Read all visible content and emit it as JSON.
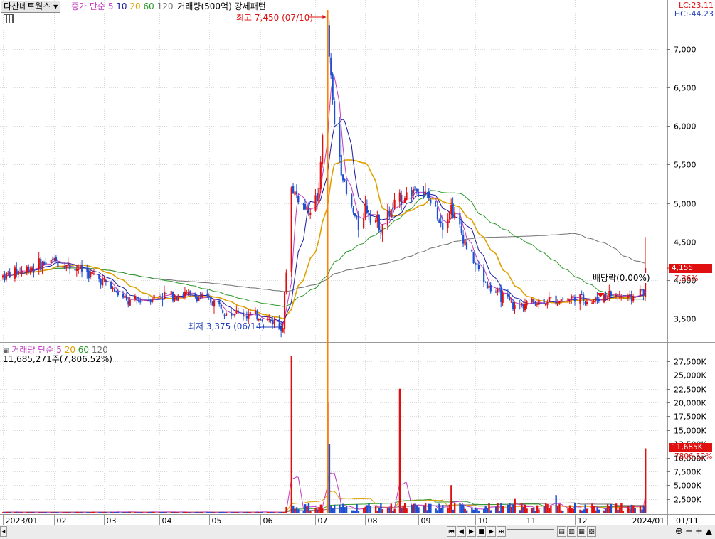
{
  "header": {
    "stock_name": "다산네트웍스",
    "ma_legend": {
      "label": "종가 단순",
      "periods": [
        "5",
        "10",
        "20",
        "60",
        "120"
      ]
    },
    "volume_label": "거래량(500억)",
    "pattern_label": "강세패턴",
    "lc": "LC:23.11",
    "hc": "HC:-44.23"
  },
  "annotations": {
    "high": "최고 7,450 (07/10)",
    "low": "최저 3,375 (06/14)",
    "dividend": "배당락(0.00%)",
    "last_price": "4,155",
    "last_change": "7.36%"
  },
  "volume_panel": {
    "legend_label": "거래량",
    "ma_legend": {
      "label": "단순",
      "periods": [
        "5",
        "20",
        "60",
        "120"
      ]
    },
    "current": "11,685,271주(7,806.52%)",
    "last_volume_tag": "11,685K",
    "last_ratio": "7806.52%"
  },
  "colors": {
    "up": "#e01010",
    "down": "#1f4fd0",
    "ma5": "#c03cc0",
    "ma10": "#1a1aa0",
    "ma20": "#e0a000",
    "ma60": "#2a9a2a",
    "ma120": "#707070",
    "marker": "#ff8000"
  },
  "chart_data": {
    "type": "candlestick",
    "price_axis": {
      "ticks": [
        3500,
        4000,
        4500,
        5000,
        5500,
        6000,
        6500,
        7000
      ],
      "tick_labels": [
        "3,500",
        "4,000",
        "4,500",
        "5,000",
        "5,500",
        "6,000",
        "6,500",
        "7,000"
      ]
    },
    "volume_axis": {
      "ticks": [
        2500,
        5000,
        7500,
        10000,
        12500,
        15000,
        17500,
        20000,
        22500,
        25000,
        27500
      ],
      "tick_labels": [
        "2,500K",
        "5,000K",
        "7,500K",
        "10,000K",
        "12,500K",
        "15,000K",
        "17,500K",
        "20,000K",
        "22,500K",
        "25,000K",
        "27,500K"
      ]
    },
    "x_labels": [
      {
        "text": "2023/01",
        "date": "2023-01-02"
      },
      {
        "text": "02",
        "date": "2023-02-01"
      },
      {
        "text": "03",
        "date": "2023-03-02"
      },
      {
        "text": "04",
        "date": "2023-04-03"
      },
      {
        "text": "05",
        "date": "2023-05-02"
      },
      {
        "text": "06",
        "date": "2023-06-01"
      },
      {
        "text": "07",
        "date": "2023-07-03"
      },
      {
        "text": "08",
        "date": "2023-08-01"
      },
      {
        "text": "09",
        "date": "2023-09-01"
      },
      {
        "text": "10",
        "date": "2023-10-04"
      },
      {
        "text": "11",
        "date": "2023-11-01"
      },
      {
        "text": "12",
        "date": "2023-12-01"
      },
      {
        "text": "2024/01",
        "date": "2024-01-02"
      },
      {
        "text": "01/11",
        "date": "2024-01-11"
      }
    ],
    "close_path": [
      [
        "2023-01-02",
        4050
      ],
      [
        "2023-01-16",
        4150
      ],
      [
        "2023-02-01",
        4250
      ],
      [
        "2023-02-15",
        4150
      ],
      [
        "2023-03-02",
        3980
      ],
      [
        "2023-03-16",
        3700
      ],
      [
        "2023-04-03",
        3800
      ],
      [
        "2023-04-17",
        3820
      ],
      [
        "2023-05-02",
        3740
      ],
      [
        "2023-05-16",
        3580
      ],
      [
        "2023-06-01",
        3520
      ],
      [
        "2023-06-14",
        3420
      ],
      [
        "2023-06-19",
        5200
      ],
      [
        "2023-06-28",
        4900
      ],
      [
        "2023-07-05",
        5100
      ],
      [
        "2023-07-10",
        7200
      ],
      [
        "2023-07-14",
        6000
      ],
      [
        "2023-07-21",
        5100
      ],
      [
        "2023-07-28",
        4700
      ],
      [
        "2023-08-01",
        4950
      ],
      [
        "2023-08-10",
        4700
      ],
      [
        "2023-08-21",
        5050
      ],
      [
        "2023-08-31",
        5200
      ],
      [
        "2023-09-07",
        5050
      ],
      [
        "2023-09-15",
        4750
      ],
      [
        "2023-09-20",
        4950
      ],
      [
        "2023-09-27",
        4550
      ],
      [
        "2023-10-04",
        4200
      ],
      [
        "2023-10-12",
        3900
      ],
      [
        "2023-10-20",
        3780
      ],
      [
        "2023-10-27",
        3640
      ],
      [
        "2023-11-01",
        3700
      ],
      [
        "2023-11-10",
        3720
      ],
      [
        "2023-11-20",
        3740
      ],
      [
        "2023-12-01",
        3780
      ],
      [
        "2023-12-11",
        3720
      ],
      [
        "2023-12-20",
        3820
      ],
      [
        "2024-01-02",
        3760
      ],
      [
        "2024-01-10",
        3870
      ],
      [
        "2024-01-11",
        4155
      ]
    ],
    "high": {
      "value": 7450,
      "date": "2023-07-10"
    },
    "low": {
      "value": 3375,
      "date": "2023-06-14"
    },
    "volume_spikes_k": [
      [
        "2023-06-19",
        28500
      ],
      [
        "2023-07-10",
        20000
      ],
      [
        "2023-07-11",
        12500
      ],
      [
        "2023-08-21",
        22500
      ],
      [
        "2023-09-20",
        5000
      ],
      [
        "2023-10-27",
        2500
      ],
      [
        "2023-11-20",
        3200
      ],
      [
        "2024-01-11",
        11685
      ]
    ],
    "last_close": 4155
  }
}
